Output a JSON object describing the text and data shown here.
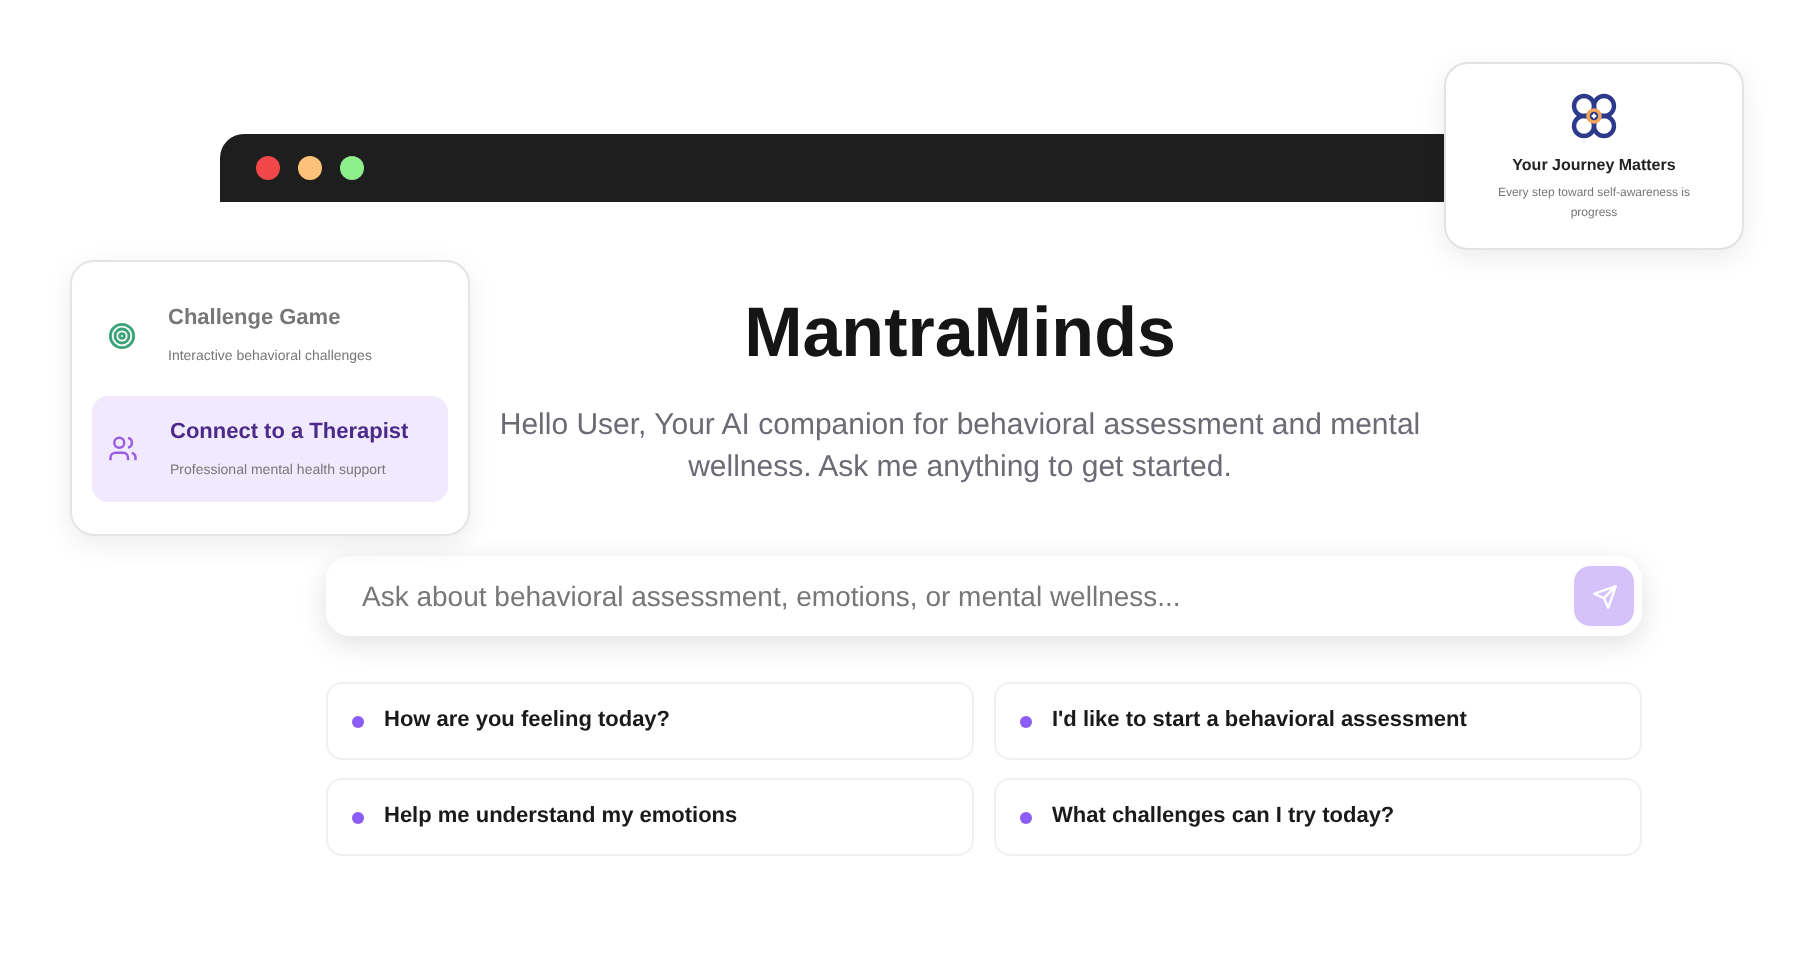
{
  "window": {
    "traffic_lights": [
      {
        "color": "#f0474a"
      },
      {
        "color": "#fcc27a"
      },
      {
        "color": "#8ef08a"
      }
    ]
  },
  "app": {
    "title": "MantraMinds",
    "subtitle": "Hello User, Your AI companion for behavioral assessment and mental wellness. Ask me anything to get started."
  },
  "chat_input": {
    "placeholder": "Ask about behavioral assessment, emotions, or mental wellness..."
  },
  "suggestions": [
    {
      "label": "How are you feeling today?"
    },
    {
      "label": "I'd like to start a behavioral assessment"
    },
    {
      "label": "Help me understand my emotions"
    },
    {
      "label": "What challenges can I try today?"
    }
  ],
  "menu_card": {
    "items": [
      {
        "kind": "target",
        "title": "Challenge Game",
        "description": "Interactive behavioral challenges",
        "selected": false
      },
      {
        "kind": "people",
        "title": "Connect to a Therapist",
        "description": "Professional mental health support",
        "selected": true
      }
    ]
  },
  "journey_card": {
    "title": "Your Journey Matters",
    "text": "Every step toward self-awareness is progress"
  }
}
